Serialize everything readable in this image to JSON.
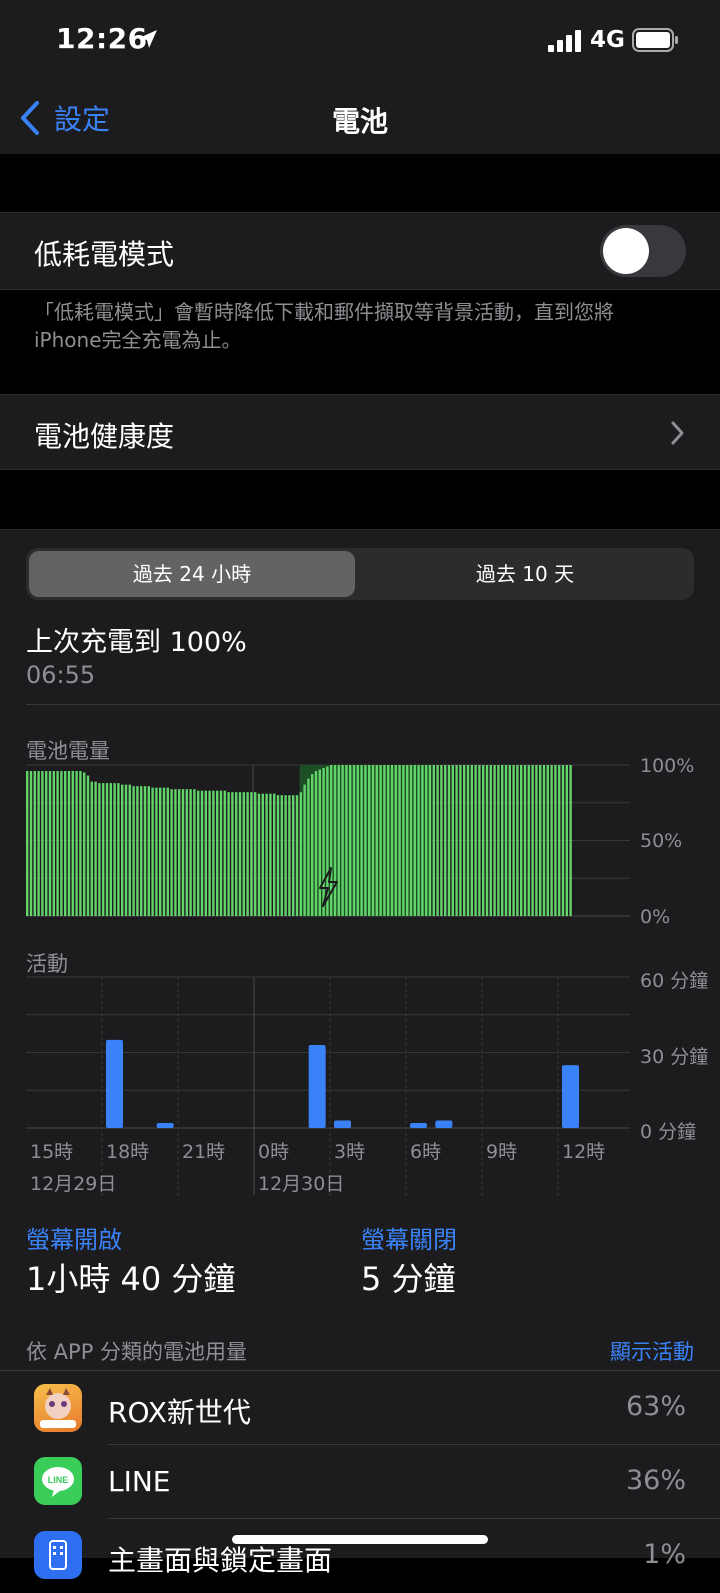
{
  "status": {
    "time": "12:26",
    "network": "4G"
  },
  "nav": {
    "back": "設定",
    "title": "電池"
  },
  "low_power": {
    "label": "低耗電模式",
    "enabled": false,
    "note_line1": "「低耗電模式」會暫時降低下載和郵件擷取等背景活動，直到您將",
    "note_line2": "iPhone完全充電為止。"
  },
  "health": {
    "label": "電池健康度"
  },
  "segment": {
    "active": "過去 24 小時",
    "inactive": "過去 10 天"
  },
  "last_charge": {
    "title": "上次充電到 100%",
    "time": "06:55"
  },
  "battery_chart": {
    "label": "電池電量",
    "ticks": [
      "100%",
      "50%",
      "0%"
    ],
    "charging_icon": "bolt-icon"
  },
  "activity_chart": {
    "label": "活動",
    "ticks": [
      "60 分鐘",
      "30 分鐘",
      "0 分鐘"
    ],
    "x_labels": [
      "15時",
      "18時",
      "21時",
      "0時",
      "3時",
      "6時",
      "9時",
      "12時"
    ],
    "date1": "12月29日",
    "date2": "12月30日"
  },
  "chart_data": [
    {
      "type": "bar",
      "title": "電池電量",
      "ylim": [
        0,
        100
      ],
      "values": [
        96,
        96,
        96,
        96,
        96,
        96,
        96,
        96,
        96,
        96,
        96,
        96,
        96,
        96,
        96,
        95,
        93,
        89,
        89,
        88,
        88,
        88,
        88,
        88,
        88,
        87,
        87,
        87,
        86,
        86,
        86,
        86,
        86,
        85,
        85,
        85,
        85,
        85,
        84,
        84,
        84,
        84,
        84,
        84,
        84,
        83,
        83,
        83,
        83,
        83,
        83,
        83,
        83,
        82,
        82,
        82,
        82,
        82,
        82,
        82,
        82,
        81,
        81,
        81,
        81,
        81,
        80,
        80,
        80,
        80,
        80,
        80,
        82,
        87,
        91,
        94,
        96,
        97,
        98,
        99,
        100,
        100,
        100,
        100,
        100,
        100,
        100,
        100,
        100,
        100,
        100,
        100,
        100,
        100,
        100,
        100,
        100,
        100,
        100,
        100,
        100,
        100,
        100,
        100,
        100,
        100,
        100,
        100,
        100,
        100,
        100,
        100,
        100,
        100,
        100,
        100,
        100,
        100,
        100,
        100,
        100,
        100,
        100,
        100,
        100,
        100,
        100,
        100,
        100,
        100,
        100,
        100,
        100,
        100,
        100,
        100,
        100,
        100,
        100,
        100,
        100,
        100,
        100,
        100
      ],
      "charging_range": [
        72,
        106
      ]
    },
    {
      "type": "bar",
      "title": "活動",
      "ylabel": "分鐘",
      "ylim": [
        0,
        60
      ],
      "categories": [
        "15時",
        "16時",
        "17時",
        "18時",
        "19時",
        "20時",
        "21時",
        "22時",
        "23時",
        "0時",
        "1時",
        "2時",
        "3時",
        "4時",
        "5時",
        "6時",
        "7時",
        "8時",
        "9時",
        "10時",
        "11時",
        "12時"
      ],
      "values": [
        0,
        0,
        0,
        35,
        0,
        2,
        0,
        0,
        0,
        0,
        0,
        33,
        3,
        0,
        0,
        2,
        3,
        0,
        0,
        0,
        0,
        25
      ]
    }
  ],
  "screen": {
    "on_label": "螢幕開啟",
    "on_value": "1小時 40 分鐘",
    "off_label": "螢幕關閉",
    "off_value": "5 分鐘"
  },
  "usage": {
    "header": "依 APP 分類的電池用量",
    "action": "顯示活動",
    "apps": [
      {
        "name": "ROX新世代",
        "pct": "63%",
        "color": "#f2a13a"
      },
      {
        "name": "LINE",
        "pct": "36%",
        "color": "#3acd5a"
      },
      {
        "name": "主畫面與鎖定畫面",
        "pct": "1%",
        "color": "#2d6ff0"
      }
    ]
  },
  "colors": {
    "accent": "#3a82f7",
    "battery_green": "#63d46a",
    "activity_blue": "#3a82f7"
  }
}
